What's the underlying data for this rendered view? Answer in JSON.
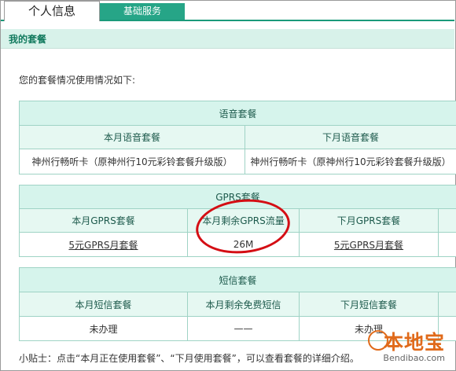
{
  "tabs": {
    "active": "个人信息",
    "inactive": "基础服务"
  },
  "section": {
    "title": "我的套餐"
  },
  "intro": "您的套餐情况使用情况如下:",
  "voice": {
    "title": "语音套餐",
    "headers": [
      "本月语音套餐",
      "下月语音套餐"
    ],
    "values": [
      "神州行畅听卡（原神州行10元彩铃套餐升级版）",
      "神州行畅听卡（原神州行10元彩铃套餐升级版）"
    ]
  },
  "gprs": {
    "title": "GPRS套餐",
    "headers": [
      "本月GPRS套餐",
      "本月剩余GPRS流量",
      "下月GPRS套餐"
    ],
    "values": [
      "5元GPRS月套餐",
      "26M",
      "5元GPRS月套餐"
    ]
  },
  "sms": {
    "title": "短信套餐",
    "headers": [
      "本月短信套餐",
      "本月剩余免费短信",
      "下月短信套餐"
    ],
    "values": [
      "未办理",
      "——",
      "未办理"
    ]
  },
  "tip": "小贴士：点击“本月正在使用套餐”、“下月使用套餐”，可以查看套餐的详细介绍。",
  "watermark": {
    "name": "本地宝",
    "url": "Bendibao.com"
  },
  "colors": {
    "tab_green": "#26a587",
    "header_bg": "#d6f4ec",
    "border": "#9fd3c5",
    "annotation_red": "#d40e14"
  }
}
